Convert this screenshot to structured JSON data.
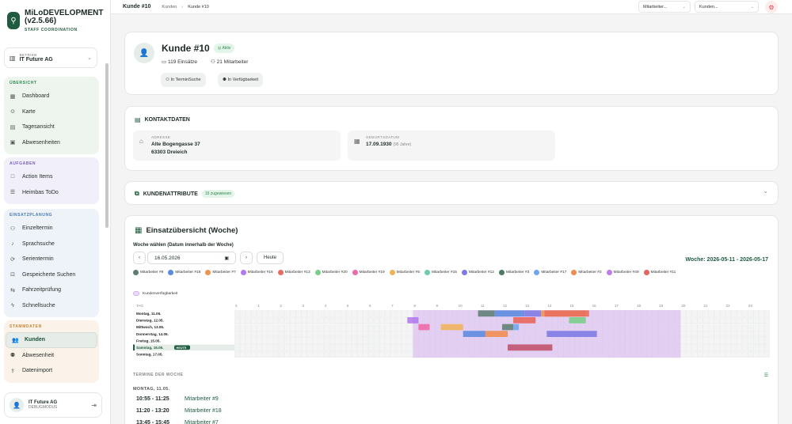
{
  "app": {
    "title": "MiLoDEVELOPMENT (v2.5.66)",
    "subtitle": "STAFF COORDINATION"
  },
  "betrieb": {
    "label": "BETRIEB",
    "value": "IT Future AG"
  },
  "nav": {
    "g1": {
      "label": "ÜBERSICHT",
      "items": [
        {
          "icon": "dashboard-icon",
          "glyph": "▦",
          "label": "Dashboard"
        },
        {
          "icon": "map-pin-icon",
          "glyph": "⊙",
          "label": "Karte"
        },
        {
          "icon": "calendar-day-icon",
          "glyph": "▤",
          "label": "Tagesansicht"
        },
        {
          "icon": "calendar-off-icon",
          "glyph": "▣",
          "label": "Abwesenheiten"
        }
      ]
    },
    "g2": {
      "label": "AUFGABEN",
      "items": [
        {
          "icon": "clipboard-icon",
          "glyph": "□",
          "label": "Action Items"
        },
        {
          "icon": "checklist-icon",
          "glyph": "☰",
          "label": "Heimbas ToDo"
        }
      ]
    },
    "g3": {
      "label": "EINSATZPLANUNG",
      "items": [
        {
          "icon": "person-run-icon",
          "glyph": "⚇",
          "label": "Einzeltermin"
        },
        {
          "icon": "microphone-icon",
          "glyph": "♪",
          "label": "Sprachsuche"
        },
        {
          "icon": "repeat-icon",
          "glyph": "⟳",
          "label": "Serientermin"
        },
        {
          "icon": "bookmark-icon",
          "glyph": "⊡",
          "label": "Gespeicherte Suchen"
        },
        {
          "icon": "route-icon",
          "glyph": "⇆",
          "label": "Fahrzeitprüfung"
        },
        {
          "icon": "bolt-icon",
          "glyph": "ϟ",
          "label": "Schnellsuche"
        }
      ]
    },
    "g4": {
      "label": "STAMMDATEN",
      "items": [
        {
          "icon": "users-icon",
          "glyph": "👥",
          "label": "Kunden",
          "active": true
        },
        {
          "icon": "user-absent-icon",
          "glyph": "⚉",
          "label": "Abwesenheit"
        },
        {
          "icon": "upload-icon",
          "glyph": "⇪",
          "label": "Datenimport"
        }
      ]
    }
  },
  "footer": {
    "name": "IT Future AG",
    "role": "DEBUGMODUS"
  },
  "topbar": {
    "title": "Kunde #10",
    "crumb1": "Kunden",
    "crumb2": "Kunde #10",
    "select1": "Mitarbeiter...",
    "select2": "Kunden..."
  },
  "hero": {
    "name": "Kunde #10",
    "status": "Aktiv",
    "einsaetze": "119 Einsätze",
    "mitarbeiter": "21 Mitarbeiter",
    "chip1": "In TerminSuche",
    "chip2": "In Verfügbarkeit"
  },
  "kontakt": {
    "title": "KONTAKTDATEN",
    "adresse_label": "ADRESSE",
    "adresse1": "Alte Bogengasse 37",
    "adresse2": "63303 Dreieich",
    "geb_label": "GEBURTSDATUM",
    "geb": "17.09.1930",
    "alter": "(95 Jahre)"
  },
  "attribute": {
    "title": "KUNDENATTRIBUTE",
    "badge": "15 zugewiesen"
  },
  "einsatz": {
    "title": "Einsatzübersicht (Woche)",
    "week_label": "Woche wählen (Datum innerhalb der Woche)",
    "date": "16.05.2026",
    "prev": "‹",
    "next": "›",
    "today": "Heute",
    "range": "Woche: 2026-05-11 - 2026-05-17",
    "legend": [
      {
        "name": "Mitarbeiter #9",
        "color": "#5e7e74"
      },
      {
        "name": "Mitarbeiter #18",
        "color": "#5b8ae0"
      },
      {
        "name": "Mitarbeiter #7",
        "color": "#f0934e"
      },
      {
        "name": "Mitarbeiter #16",
        "color": "#b379ec"
      },
      {
        "name": "Mitarbeiter #13",
        "color": "#e96d5e"
      },
      {
        "name": "Mitarbeiter #20",
        "color": "#78cf8a"
      },
      {
        "name": "Mitarbeiter #19",
        "color": "#ee69a8"
      },
      {
        "name": "Mitarbeiter #5",
        "color": "#f0b35a"
      },
      {
        "name": "Mitarbeiter #15",
        "color": "#6dcbb0"
      },
      {
        "name": "Mitarbeiter #12",
        "color": "#7d7ae4"
      },
      {
        "name": "Mitarbeiter #3",
        "color": "#4c7a63"
      },
      {
        "name": "Mitarbeiter #17",
        "color": "#6ea7f0"
      },
      {
        "name": "Mitarbeiter #2",
        "color": "#f08c4d"
      },
      {
        "name": "Mitarbeiter #49",
        "color": "#c07ce9"
      },
      {
        "name": "Mitarbeiter #11",
        "color": "#e8645a"
      }
    ],
    "availability_label": "Kundenverfügbarkeit",
    "tag_label": "TAG",
    "today_badge": "HEUTE",
    "days": [
      "Montag, 11.05.",
      "Dienstag, 12.05.",
      "Mittwoch, 13.05.",
      "Donnerstag, 14.05.",
      "Freitag, 15.05.",
      "Samstag, 16.05.",
      "Sonntag, 17.05."
    ],
    "today_index": 5,
    "hours": [
      "0",
      "1",
      "2",
      "3",
      "4",
      "5",
      "6",
      "7",
      "8",
      "9",
      "10",
      "11",
      "12",
      "13",
      "14",
      "15",
      "16",
      "17",
      "18",
      "19",
      "20",
      "21",
      "22",
      "23"
    ]
  },
  "chart_data": {
    "type": "gantt",
    "x_unit": "hour of day",
    "x_range": [
      0,
      24
    ],
    "availability": [
      {
        "day": 0,
        "from": 8,
        "to": 20
      },
      {
        "day": 1,
        "from": 8,
        "to": 20
      },
      {
        "day": 2,
        "from": 8,
        "to": 20
      },
      {
        "day": 3,
        "from": 8,
        "to": 20
      },
      {
        "day": 4,
        "from": 8,
        "to": 20
      },
      {
        "day": 5,
        "from": 8,
        "to": 20
      },
      {
        "day": 6,
        "from": 8,
        "to": 20
      }
    ],
    "bars": [
      {
        "day": 0,
        "from": 10.92,
        "to": 11.67,
        "who": "Mitarbeiter #9",
        "color": "#5e7e74"
      },
      {
        "day": 0,
        "from": 11.67,
        "to": 13.0,
        "who": "Mitarbeiter #18",
        "color": "#5b8ae0"
      },
      {
        "day": 0,
        "from": 13.0,
        "to": 13.75,
        "who": "Mitarbeiter #12",
        "color": "#7d7ae4"
      },
      {
        "day": 0,
        "from": 13.75,
        "to": 15.75,
        "who": "Mitarbeiter #7",
        "color": "#f0934e"
      },
      {
        "day": 0,
        "from": 13.9,
        "to": 15.9,
        "who": "Mitarbeiter #13",
        "color": "#e96d5e"
      },
      {
        "day": 1,
        "from": 7.75,
        "to": 8.25,
        "who": "Mitarbeiter #16",
        "color": "#b379ec"
      },
      {
        "day": 1,
        "from": 12.5,
        "to": 13.5,
        "who": "Mitarbeiter #11",
        "color": "#e8645a"
      },
      {
        "day": 1,
        "from": 15.0,
        "to": 15.75,
        "who": "Mitarbeiter #20",
        "color": "#78cf8a"
      },
      {
        "day": 2,
        "from": 8.25,
        "to": 8.75,
        "who": "Mitarbeiter #19",
        "color": "#ee69a8"
      },
      {
        "day": 2,
        "from": 9.25,
        "to": 10.25,
        "who": "Mitarbeiter #5",
        "color": "#f0b35a"
      },
      {
        "day": 2,
        "from": 12.0,
        "to": 12.5,
        "who": "Mitarbeiter #9",
        "color": "#5e7e74"
      },
      {
        "day": 2,
        "from": 12.5,
        "to": 12.75,
        "who": "Mitarbeiter #17",
        "color": "#6ea7f0"
      },
      {
        "day": 3,
        "from": 10.25,
        "to": 11.25,
        "who": "Mitarbeiter #18",
        "color": "#5b8ae0"
      },
      {
        "day": 3,
        "from": 11.25,
        "to": 12.25,
        "who": "Mitarbeiter #2",
        "color": "#f08c4d"
      },
      {
        "day": 3,
        "from": 14.0,
        "to": 16.25,
        "who": "Mitarbeiter #12",
        "color": "#7d7ae4"
      },
      {
        "day": 5,
        "from": 12.25,
        "to": 14.25,
        "who": "Mitarbeiter #13",
        "color": "#c0506a"
      }
    ]
  },
  "termine": {
    "title": "TERMINE DER WOCHE",
    "day": "MONTAG, 11.05.",
    "rows": [
      {
        "time": "10:55 - 11:25",
        "who": "Mitarbeiter #9"
      },
      {
        "time": "11:20 - 13:20",
        "who": "Mitarbeiter #18"
      },
      {
        "time": "13:45 - 15:45",
        "who": "Mitarbeiter #7"
      }
    ]
  }
}
